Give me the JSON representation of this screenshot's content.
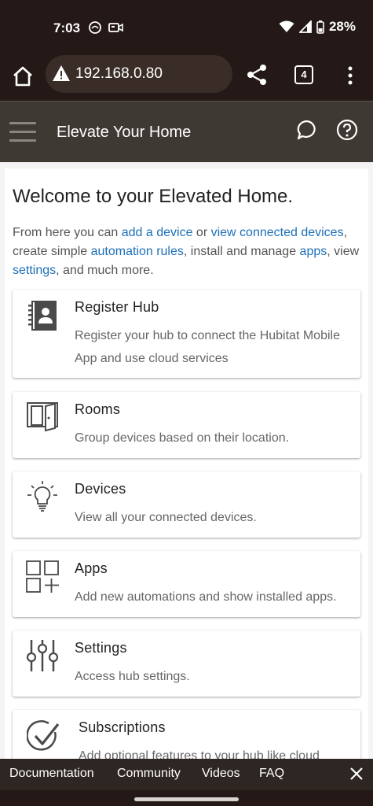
{
  "status_bar": {
    "time": "7:03",
    "battery": "28%"
  },
  "browser": {
    "url": "192.168.0.80",
    "tab_count": "4"
  },
  "header": {
    "title": "Elevate Your Home"
  },
  "main": {
    "welcome": "Welcome to your Elevated Home.",
    "intro": {
      "t1": "From here you can ",
      "link_add_device": "add a device",
      "t2": " or ",
      "link_view_connected": "view connected devices",
      "t3": ", create simple ",
      "link_automation": "automation rules",
      "t4": ", install and manage ",
      "link_apps": "apps",
      "t5": ", view ",
      "link_settings": "settings",
      "t6": ", and much more."
    },
    "cards": [
      {
        "title": "Register Hub",
        "description": "Register your hub to connect the Hubitat Mobile App and use cloud services",
        "icon": "contact-book-icon"
      },
      {
        "title": "Rooms",
        "description": "Group devices based on their location.",
        "icon": "door-icon"
      },
      {
        "title": "Devices",
        "description": "View all your connected devices.",
        "icon": "lightbulb-icon"
      },
      {
        "title": "Apps",
        "description": "Add new automations and show installed apps.",
        "icon": "apps-grid-icon"
      },
      {
        "title": "Settings",
        "description": "Access hub settings.",
        "icon": "sliders-icon"
      },
      {
        "title": "Subscriptions",
        "description": "Add optional features to your hub like cloud",
        "icon": "check-circle-icon"
      }
    ]
  },
  "footer": {
    "links": [
      "Documentation",
      "Community",
      "Videos",
      "FAQ"
    ]
  },
  "colors": {
    "status_bg": "#241916",
    "header_bg": "#3f3934",
    "link": "#1d6fb8",
    "footer_bg": "#2e2622"
  }
}
